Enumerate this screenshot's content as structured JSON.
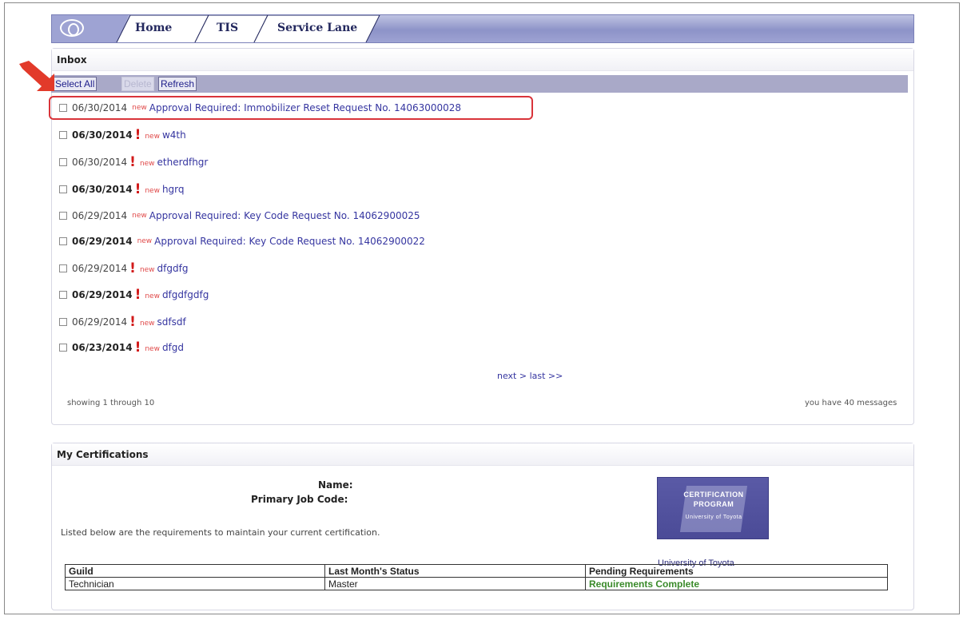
{
  "nav": {
    "tabs": [
      {
        "label": "Home"
      },
      {
        "label": "TIS"
      },
      {
        "label": "Service Lane"
      }
    ]
  },
  "inbox": {
    "title": "Inbox",
    "toolbar": {
      "select_all": "Select All",
      "delete": "Delete",
      "refresh": "Refresh"
    },
    "messages": [
      {
        "date": "06/30/2014",
        "important": false,
        "unread": false,
        "badge": "new",
        "subject": "Approval Required: Immobilizer Reset Request No. 14063000028"
      },
      {
        "date": "06/30/2014",
        "important": true,
        "unread": true,
        "badge": "new",
        "subject": "w4th"
      },
      {
        "date": "06/30/2014",
        "important": true,
        "unread": false,
        "badge": "new",
        "subject": "etherdfhgr"
      },
      {
        "date": "06/30/2014",
        "important": true,
        "unread": true,
        "badge": "new",
        "subject": "hgrq"
      },
      {
        "date": "06/29/2014",
        "important": false,
        "unread": false,
        "badge": "new",
        "subject": "Approval Required: Key Code Request No. 14062900025"
      },
      {
        "date": "06/29/2014",
        "important": false,
        "unread": true,
        "badge": "new",
        "subject": "Approval Required: Key Code Request No. 14062900022"
      },
      {
        "date": "06/29/2014",
        "important": true,
        "unread": false,
        "badge": "new",
        "subject": "dfgdfg"
      },
      {
        "date": "06/29/2014",
        "important": true,
        "unread": true,
        "badge": "new",
        "subject": "dfgdfgdfg"
      },
      {
        "date": "06/29/2014",
        "important": true,
        "unread": false,
        "badge": "new",
        "subject": "sdfsdf"
      },
      {
        "date": "06/23/2014",
        "important": true,
        "unread": true,
        "badge": "new",
        "subject": "dfgd"
      }
    ],
    "pager": "next > last >>",
    "showing": "showing 1 through 10",
    "count_text": "you have 40 messages"
  },
  "certifications": {
    "title": "My Certifications",
    "name_label": "Name:",
    "job_code_label": "Primary Job Code:",
    "note": "Listed below are the requirements to maintain your current certification.",
    "badge": {
      "line1": "CERTIFICATION",
      "line2": "PROGRAM",
      "line3": "University of Toyota"
    },
    "badge_caption": "University of Toyota",
    "table": {
      "headers": [
        "Guild",
        "Last Month's Status",
        "Pending Requirements"
      ],
      "rows": [
        [
          "Technician",
          "Master",
          "Requirements Complete"
        ]
      ]
    }
  },
  "colors": {
    "accent": "#8d93c8",
    "highlight": "#d9343a",
    "complete": "#3a8a2a"
  }
}
